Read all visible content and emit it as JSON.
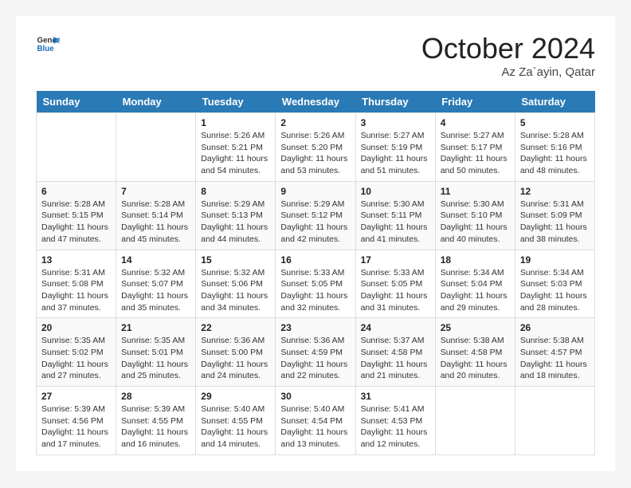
{
  "header": {
    "logo_line1": "General",
    "logo_line2": "Blue",
    "month": "October 2024",
    "location": "Az Za`ayin, Qatar"
  },
  "weekdays": [
    "Sunday",
    "Monday",
    "Tuesday",
    "Wednesday",
    "Thursday",
    "Friday",
    "Saturday"
  ],
  "weeks": [
    [
      {
        "day": "",
        "info": ""
      },
      {
        "day": "",
        "info": ""
      },
      {
        "day": "1",
        "info": "Sunrise: 5:26 AM\nSunset: 5:21 PM\nDaylight: 11 hours and 54 minutes."
      },
      {
        "day": "2",
        "info": "Sunrise: 5:26 AM\nSunset: 5:20 PM\nDaylight: 11 hours and 53 minutes."
      },
      {
        "day": "3",
        "info": "Sunrise: 5:27 AM\nSunset: 5:19 PM\nDaylight: 11 hours and 51 minutes."
      },
      {
        "day": "4",
        "info": "Sunrise: 5:27 AM\nSunset: 5:17 PM\nDaylight: 11 hours and 50 minutes."
      },
      {
        "day": "5",
        "info": "Sunrise: 5:28 AM\nSunset: 5:16 PM\nDaylight: 11 hours and 48 minutes."
      }
    ],
    [
      {
        "day": "6",
        "info": "Sunrise: 5:28 AM\nSunset: 5:15 PM\nDaylight: 11 hours and 47 minutes."
      },
      {
        "day": "7",
        "info": "Sunrise: 5:28 AM\nSunset: 5:14 PM\nDaylight: 11 hours and 45 minutes."
      },
      {
        "day": "8",
        "info": "Sunrise: 5:29 AM\nSunset: 5:13 PM\nDaylight: 11 hours and 44 minutes."
      },
      {
        "day": "9",
        "info": "Sunrise: 5:29 AM\nSunset: 5:12 PM\nDaylight: 11 hours and 42 minutes."
      },
      {
        "day": "10",
        "info": "Sunrise: 5:30 AM\nSunset: 5:11 PM\nDaylight: 11 hours and 41 minutes."
      },
      {
        "day": "11",
        "info": "Sunrise: 5:30 AM\nSunset: 5:10 PM\nDaylight: 11 hours and 40 minutes."
      },
      {
        "day": "12",
        "info": "Sunrise: 5:31 AM\nSunset: 5:09 PM\nDaylight: 11 hours and 38 minutes."
      }
    ],
    [
      {
        "day": "13",
        "info": "Sunrise: 5:31 AM\nSunset: 5:08 PM\nDaylight: 11 hours and 37 minutes."
      },
      {
        "day": "14",
        "info": "Sunrise: 5:32 AM\nSunset: 5:07 PM\nDaylight: 11 hours and 35 minutes."
      },
      {
        "day": "15",
        "info": "Sunrise: 5:32 AM\nSunset: 5:06 PM\nDaylight: 11 hours and 34 minutes."
      },
      {
        "day": "16",
        "info": "Sunrise: 5:33 AM\nSunset: 5:05 PM\nDaylight: 11 hours and 32 minutes."
      },
      {
        "day": "17",
        "info": "Sunrise: 5:33 AM\nSunset: 5:05 PM\nDaylight: 11 hours and 31 minutes."
      },
      {
        "day": "18",
        "info": "Sunrise: 5:34 AM\nSunset: 5:04 PM\nDaylight: 11 hours and 29 minutes."
      },
      {
        "day": "19",
        "info": "Sunrise: 5:34 AM\nSunset: 5:03 PM\nDaylight: 11 hours and 28 minutes."
      }
    ],
    [
      {
        "day": "20",
        "info": "Sunrise: 5:35 AM\nSunset: 5:02 PM\nDaylight: 11 hours and 27 minutes."
      },
      {
        "day": "21",
        "info": "Sunrise: 5:35 AM\nSunset: 5:01 PM\nDaylight: 11 hours and 25 minutes."
      },
      {
        "day": "22",
        "info": "Sunrise: 5:36 AM\nSunset: 5:00 PM\nDaylight: 11 hours and 24 minutes."
      },
      {
        "day": "23",
        "info": "Sunrise: 5:36 AM\nSunset: 4:59 PM\nDaylight: 11 hours and 22 minutes."
      },
      {
        "day": "24",
        "info": "Sunrise: 5:37 AM\nSunset: 4:58 PM\nDaylight: 11 hours and 21 minutes."
      },
      {
        "day": "25",
        "info": "Sunrise: 5:38 AM\nSunset: 4:58 PM\nDaylight: 11 hours and 20 minutes."
      },
      {
        "day": "26",
        "info": "Sunrise: 5:38 AM\nSunset: 4:57 PM\nDaylight: 11 hours and 18 minutes."
      }
    ],
    [
      {
        "day": "27",
        "info": "Sunrise: 5:39 AM\nSunset: 4:56 PM\nDaylight: 11 hours and 17 minutes."
      },
      {
        "day": "28",
        "info": "Sunrise: 5:39 AM\nSunset: 4:55 PM\nDaylight: 11 hours and 16 minutes."
      },
      {
        "day": "29",
        "info": "Sunrise: 5:40 AM\nSunset: 4:55 PM\nDaylight: 11 hours and 14 minutes."
      },
      {
        "day": "30",
        "info": "Sunrise: 5:40 AM\nSunset: 4:54 PM\nDaylight: 11 hours and 13 minutes."
      },
      {
        "day": "31",
        "info": "Sunrise: 5:41 AM\nSunset: 4:53 PM\nDaylight: 11 hours and 12 minutes."
      },
      {
        "day": "",
        "info": ""
      },
      {
        "day": "",
        "info": ""
      }
    ]
  ]
}
